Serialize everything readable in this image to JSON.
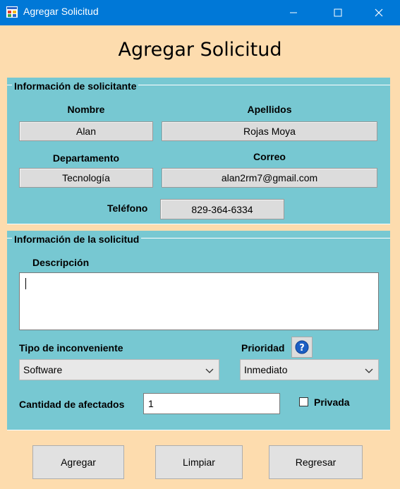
{
  "window": {
    "title": "Agregar Solicitud",
    "accent_color": "#0078d7"
  },
  "heading": "Agregar Solicitud",
  "requester_group": {
    "title": "Información de solicitante",
    "nombre_label": "Nombre",
    "nombre_value": "Alan",
    "apellidos_label": "Apellidos",
    "apellidos_value": "Rojas Moya",
    "departamento_label": "Departamento",
    "departamento_value": "Tecnología",
    "correo_label": "Correo",
    "correo_value": "alan2rm7@gmail.com",
    "telefono_label": "Teléfono",
    "telefono_value": "829-364-6334"
  },
  "request_group": {
    "title": "Información de la solicitud",
    "descripcion_label": "Descripción",
    "descripcion_value": "",
    "tipo_label": "Tipo de inconveniente",
    "tipo_value": "Software",
    "prioridad_label": "Prioridad",
    "prioridad_value": "Inmediato",
    "cantidad_label": "Cantidad de afectados",
    "cantidad_value": "1",
    "privada_label": "Privada",
    "privada_checked": false
  },
  "buttons": {
    "agregar": "Agregar",
    "limpiar": "Limpiar",
    "regresar": "Regresar"
  },
  "colors": {
    "background": "#fddcae",
    "panel": "#77c8d2",
    "help_icon": "#1c5fc4"
  }
}
